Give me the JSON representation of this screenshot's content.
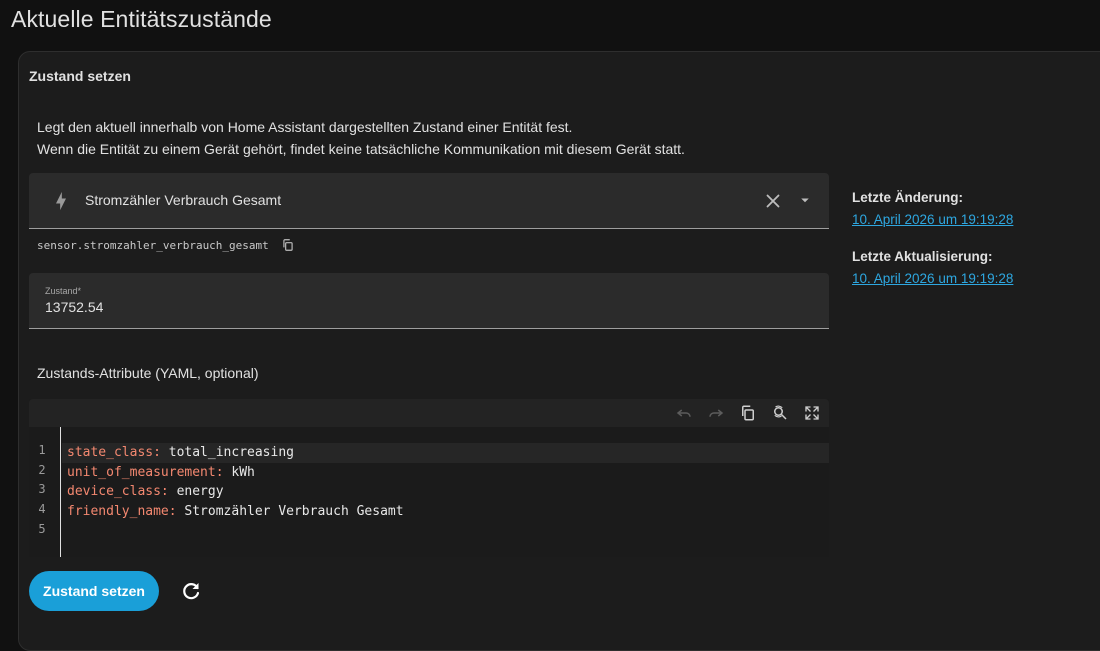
{
  "page": {
    "title": "Aktuelle Entitätszustände"
  },
  "card": {
    "header": "Zustand setzen",
    "description_line1": "Legt den aktuell innerhalb von Home Assistant dargestellten Zustand einer Entität fest.",
    "description_line2": "Wenn die Entität zu einem Gerät gehört, findet keine tatsächliche Kommunikation mit diesem Gerät statt."
  },
  "entity_picker": {
    "icon": "lightning-bolt-icon",
    "name": "Stromzähler Verbrauch Gesamt",
    "entity_id": "sensor.stromzahler_verbrauch_gesamt"
  },
  "state_field": {
    "label": "Zustand*",
    "value": "13752.54"
  },
  "attributes": {
    "title": "Zustands-Attribute (YAML, optional)",
    "line_numbers": [
      "1",
      "2",
      "3",
      "4",
      "5"
    ],
    "lines": [
      {
        "key": "state_class",
        "value": "total_increasing"
      },
      {
        "key": "unit_of_measurement",
        "value": "kWh"
      },
      {
        "key": "device_class",
        "value": "energy"
      },
      {
        "key": "friendly_name",
        "value": "Stromzähler Verbrauch Gesamt"
      }
    ],
    "separator": ": "
  },
  "meta": {
    "last_changed_label": "Letzte Änderung:",
    "last_changed_value": "10. April 2026 um 19:19:28",
    "last_updated_label": "Letzte Aktualisierung:",
    "last_updated_value": "10. April 2026 um 19:19:28"
  },
  "actions": {
    "submit_label": "Zustand setzen",
    "refresh_icon": "refresh-icon"
  },
  "colors": {
    "accent": "#1a9fd8",
    "link": "#2ea7e0",
    "yaml_key": "#f48870"
  }
}
